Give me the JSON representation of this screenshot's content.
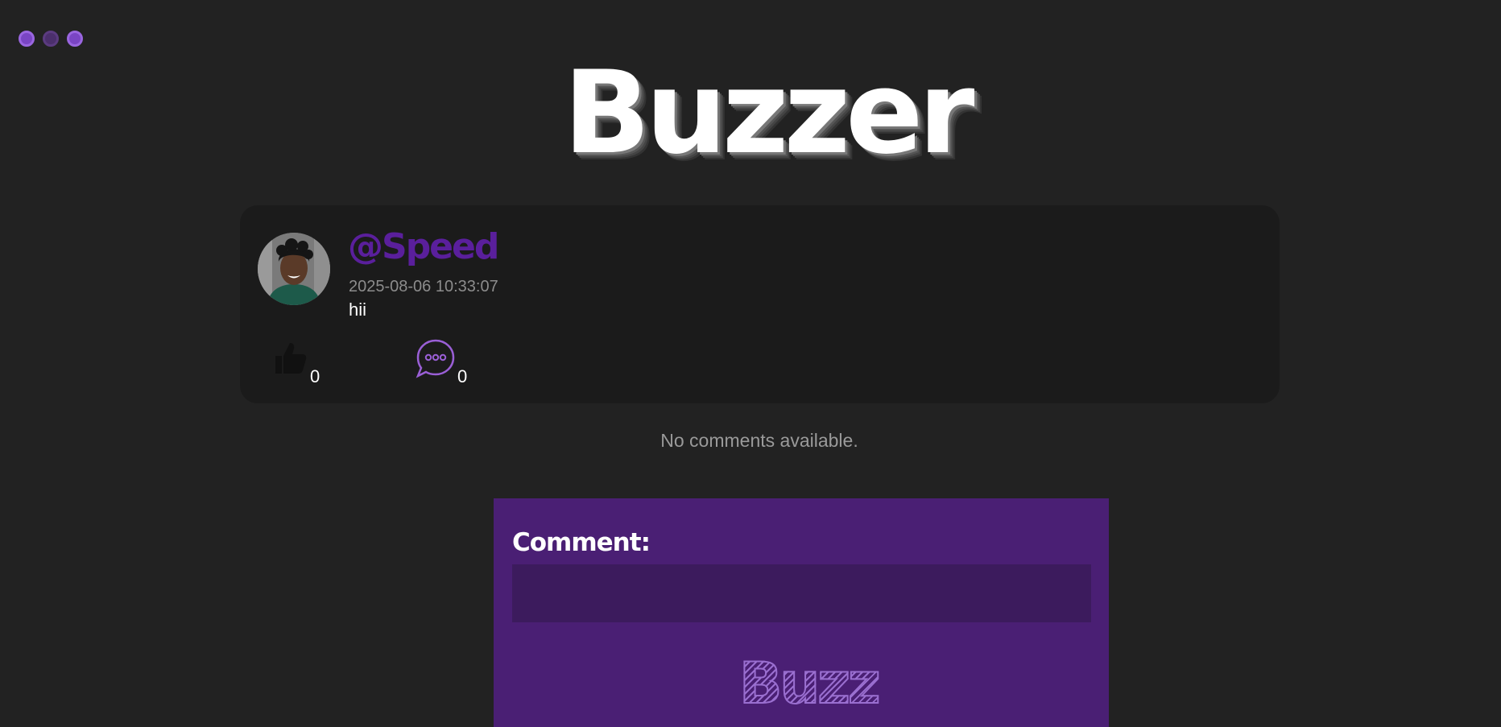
{
  "window": {
    "dots": [
      "close-dot",
      "minimize-dot",
      "maximize-dot"
    ]
  },
  "brand": {
    "title": "Buzzer"
  },
  "post": {
    "username": "@Speed",
    "timestamp": "2025-08-06 10:33:07",
    "body": "hii",
    "likes": "0",
    "comments": "0",
    "like_icon": "thumbs-up-icon",
    "comment_icon": "speech-bubble-icon"
  },
  "comments_section": {
    "empty_message": "No comments available."
  },
  "comment_form": {
    "label": "Comment:",
    "input_value": "",
    "submit_label": "Buzz"
  },
  "colors": {
    "background": "#222222",
    "card": "#1b1b1b",
    "accent": "#5a1f9c",
    "form": "#4a1f74",
    "input": "#3c1b5d"
  }
}
